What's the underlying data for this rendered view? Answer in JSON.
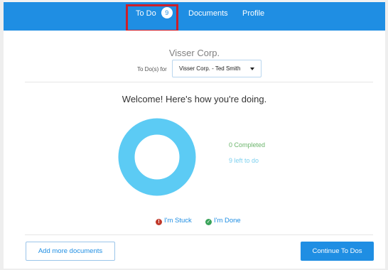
{
  "nav": {
    "tabs": [
      {
        "label": "To Do",
        "badge": "9"
      },
      {
        "label": "Documents"
      },
      {
        "label": "Profile"
      }
    ]
  },
  "header": {
    "company": "Visser Corp.",
    "for_label": "To Do(s) for",
    "selected_account": "Visser Corp. - Ted Smith"
  },
  "progress": {
    "title": "Welcome! Here's how you're doing.",
    "completed_label": "0 Completed",
    "left_label": "9 left to do",
    "completed_count": 0,
    "left_count": 9,
    "colors": {
      "completed": "#6cb56c",
      "remaining": "#5ccbf4"
    }
  },
  "actions": {
    "stuck_label": "I'm Stuck",
    "done_label": "I'm Done",
    "add_documents_label": "Add more documents",
    "continue_label": "Continue To Dos"
  },
  "icons": {
    "stuck": "exclamation-circle-icon",
    "done": "check-circle-icon",
    "select": "caret-down-icon"
  },
  "colors": {
    "accent": "#1f8ee3",
    "highlight": "#cc1f2a"
  }
}
